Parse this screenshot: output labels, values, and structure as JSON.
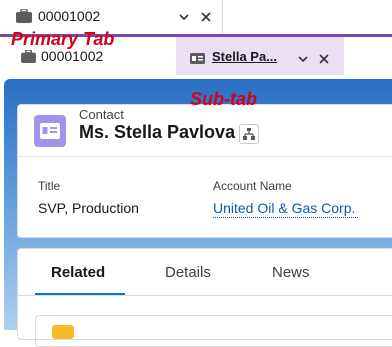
{
  "primary_tab": {
    "label": "00001002",
    "icon": "case-icon"
  },
  "sub_tabs": [
    {
      "label": "00001002",
      "icon": "case-icon",
      "active": false
    },
    {
      "label": "Stella Pa...",
      "icon": "contact-card-icon",
      "active": true
    }
  ],
  "annotations": {
    "primary": "Primary Tab",
    "sub": "Sub-tab"
  },
  "record": {
    "object_type": "Contact",
    "name": "Ms. Stella Pavlova",
    "fields": [
      {
        "label": "Title",
        "value": "SVP, Production"
      },
      {
        "label": "Account Name",
        "value": "United Oil & Gas Corp."
      }
    ]
  },
  "related_tabs": [
    "Related",
    "Details",
    "News"
  ],
  "colors": {
    "primary_underline": "#7c4aa8",
    "active_subtab_bg": "#eadff3",
    "contact_icon": "#a094ed",
    "link": "#0b5cab",
    "annotation": "#d6001c"
  }
}
